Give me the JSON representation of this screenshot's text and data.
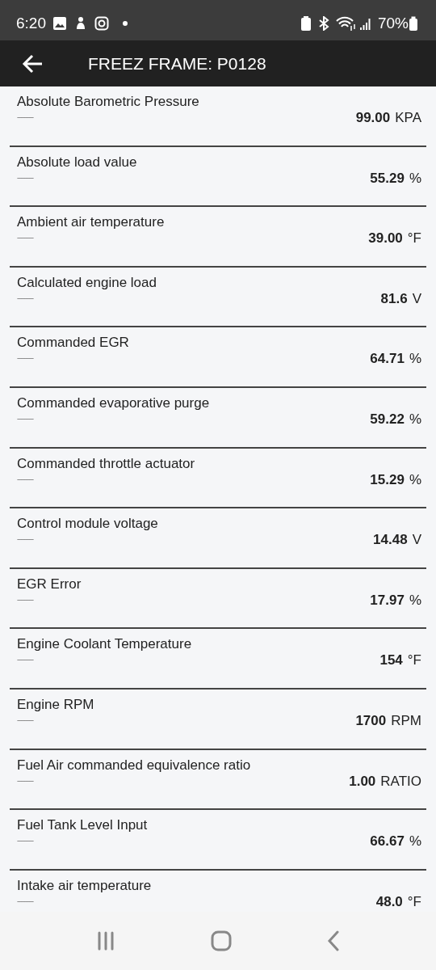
{
  "status_bar": {
    "time": "6:20",
    "battery": "70%"
  },
  "app_bar": {
    "title": "FREEZ FRAME: P0128"
  },
  "rows": [
    {
      "name": "Absolute Barometric Pressure",
      "subtitle": "----------",
      "value": "99.00",
      "unit": "KPA"
    },
    {
      "name": "Absolute load value",
      "subtitle": "----------",
      "value": "55.29",
      "unit": "%"
    },
    {
      "name": "Ambient air temperature",
      "subtitle": "----------",
      "value": "39.00",
      "unit": "°F"
    },
    {
      "name": "Calculated engine load",
      "subtitle": "----------",
      "value": "81.6",
      "unit": "V"
    },
    {
      "name": "Commanded EGR",
      "subtitle": "----------",
      "value": "64.71",
      "unit": "%"
    },
    {
      "name": "Commanded evaporative purge",
      "subtitle": "----------",
      "value": "59.22",
      "unit": "%"
    },
    {
      "name": "Commanded throttle actuator",
      "subtitle": "----------",
      "value": "15.29",
      "unit": "%"
    },
    {
      "name": "Control module voltage",
      "subtitle": "----------",
      "value": "14.48",
      "unit": "V"
    },
    {
      "name": "EGR Error",
      "subtitle": "----------",
      "value": "17.97",
      "unit": "%"
    },
    {
      "name": "Engine Coolant Temperature",
      "subtitle": "----------",
      "value": "154",
      "unit": "°F"
    },
    {
      "name": "Engine RPM",
      "subtitle": "----------",
      "value": "1700",
      "unit": "RPM"
    },
    {
      "name": "Fuel Air commanded equivalence ratio",
      "subtitle": "----------",
      "value": "1.00",
      "unit": "RATIO"
    },
    {
      "name": "Fuel Tank Level Input",
      "subtitle": "----------",
      "value": "66.67",
      "unit": "%"
    },
    {
      "name": "Intake air temperature",
      "subtitle": "----------",
      "value": "48.0",
      "unit": "°F"
    }
  ]
}
